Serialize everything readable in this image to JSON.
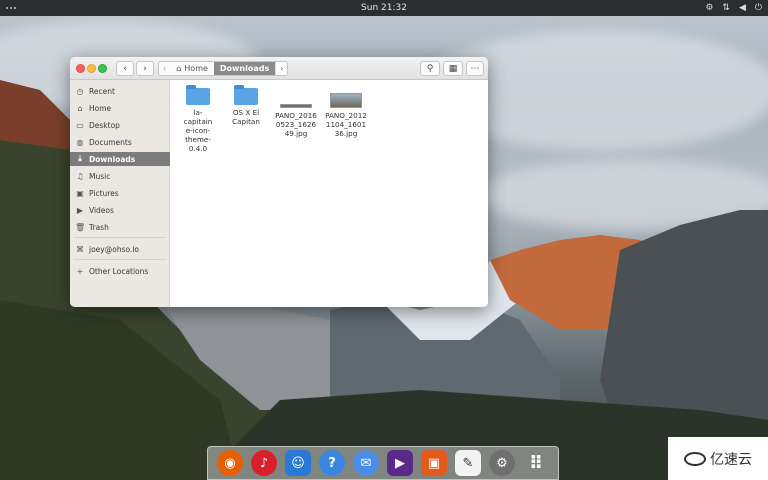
{
  "top_panel": {
    "clock": "Sun 21:32"
  },
  "window": {
    "title_path": [
      {
        "label": "Home",
        "active": false
      },
      {
        "label": "Downloads",
        "active": true
      }
    ],
    "sidebar": {
      "items": [
        {
          "icon": "clock-icon",
          "glyph": "◷",
          "label": "Recent",
          "selected": false
        },
        {
          "icon": "home-icon",
          "glyph": "⌂",
          "label": "Home",
          "selected": false
        },
        {
          "icon": "desktop-icon",
          "glyph": "▭",
          "label": "Desktop",
          "selected": false
        },
        {
          "icon": "documents-icon",
          "glyph": "◍",
          "label": "Documents",
          "selected": false
        },
        {
          "icon": "download-icon",
          "glyph": "⤓",
          "label": "Downloads",
          "selected": true
        },
        {
          "icon": "music-icon",
          "glyph": "♫",
          "label": "Music",
          "selected": false
        },
        {
          "icon": "camera-icon",
          "glyph": "▣",
          "label": "Pictures",
          "selected": false
        },
        {
          "icon": "video-icon",
          "glyph": "▶",
          "label": "Videos",
          "selected": false
        },
        {
          "icon": "trash-icon",
          "glyph": "🗑",
          "label": "Trash",
          "selected": false
        },
        {
          "icon": "network-icon",
          "glyph": "⌘",
          "label": "joey@ohso.lo",
          "selected": false
        },
        {
          "icon": "plus-icon",
          "glyph": "+",
          "label": "Other Locations",
          "selected": false
        }
      ]
    },
    "files": [
      {
        "type": "folder",
        "name": "la-capitaine-icon-theme-0.4.0"
      },
      {
        "type": "folder",
        "name": "OS X El Capitan"
      },
      {
        "type": "image",
        "name": "PANO_20160523_162649.jpg"
      },
      {
        "type": "image",
        "name": "PANO_20121104_160136.jpg"
      }
    ]
  },
  "dock": {
    "items": [
      {
        "icon": "firefox-icon",
        "color": "#e66000",
        "glyph": "◉"
      },
      {
        "icon": "itunes-icon",
        "color": "#d81f2a",
        "glyph": "♪"
      },
      {
        "icon": "finder-icon",
        "color": "#2b79d6",
        "glyph": "☺"
      },
      {
        "icon": "help-icon",
        "color": "#3a86e0",
        "glyph": "?"
      },
      {
        "icon": "mail-icon",
        "color": "#4b8ee8",
        "glyph": "✉"
      },
      {
        "icon": "video-editor-icon",
        "color": "#5a2a8a",
        "glyph": "▶"
      },
      {
        "icon": "photos-icon",
        "color": "#e25a1c",
        "glyph": "▣"
      },
      {
        "icon": "gimp-icon",
        "color": "#7a6a55",
        "glyph": "✎"
      },
      {
        "icon": "settings-icon",
        "color": "#6f6f6f",
        "glyph": "⚙"
      },
      {
        "icon": "app-grid-icon",
        "color": "#3a3a3a",
        "glyph": "⠿"
      }
    ]
  },
  "watermark": {
    "text": "亿速云"
  }
}
